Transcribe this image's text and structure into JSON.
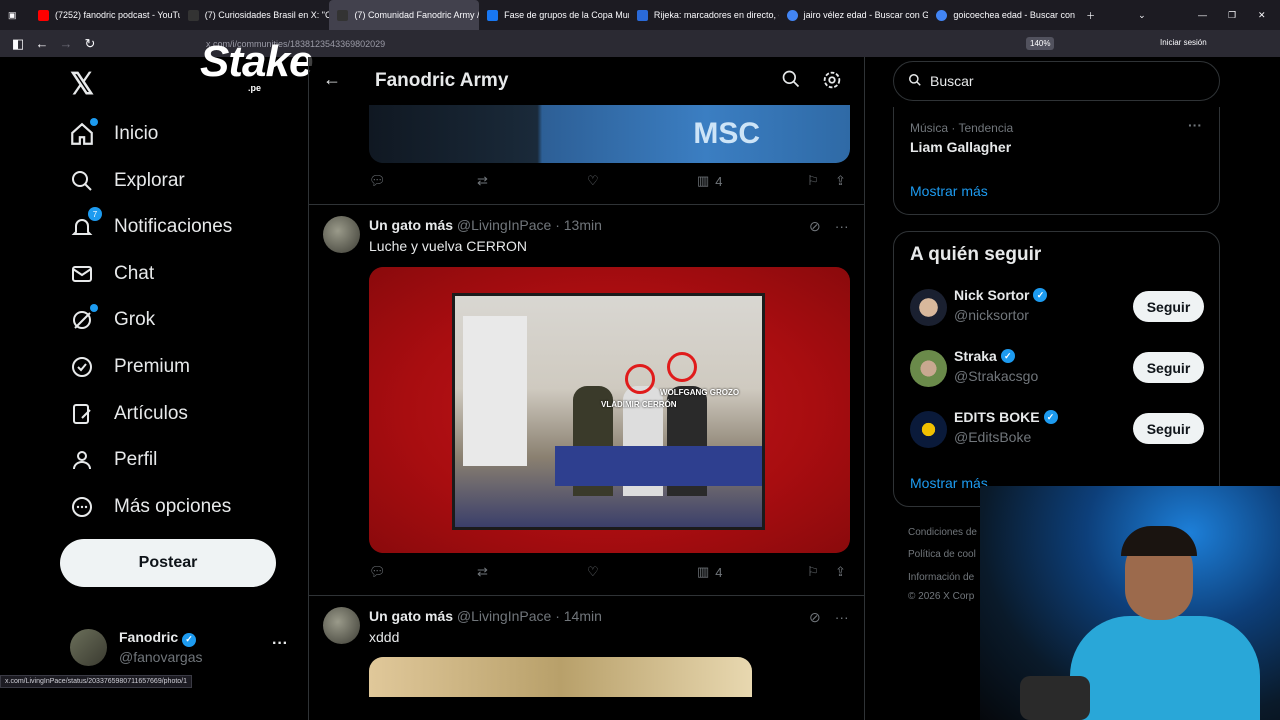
{
  "browser": {
    "tabs": [
      {
        "label": "(7252) fanodric podcast - YouTu",
        "color": "#ff0000"
      },
      {
        "label": "(7) Curiosidades Brasil en X: \"Cc",
        "color": "#333333"
      },
      {
        "label": "(7) Comunidad Fanodric Army /",
        "color": "#333333",
        "active": true
      },
      {
        "label": "Fase de grupos de la Copa Mun",
        "color": "#1877f2"
      },
      {
        "label": "Rijeka: marcadores en directo, c",
        "color": "#2a6ad8"
      },
      {
        "label": "jairo vélez edad - Buscar con G",
        "color": "#4285f4"
      },
      {
        "label": "goicoechea edad - Buscar con G",
        "color": "#4285f4"
      }
    ],
    "url": "x.com/i/communities/1838123543369802029",
    "zoom": "140%",
    "login": "Iniciar sesión",
    "status_url": "x.com/LivingInPace/status/2033765980711657669/photo/1"
  },
  "overlay": {
    "brand": "Stake",
    "brand_sub": ".pe"
  },
  "sidebar": {
    "items": [
      {
        "label": "Inicio",
        "icon": "home-icon"
      },
      {
        "label": "Explorar",
        "icon": "search-icon"
      },
      {
        "label": "Notificaciones",
        "icon": "bell-icon",
        "badge": "7"
      },
      {
        "label": "Chat",
        "icon": "mail-icon"
      },
      {
        "label": "Grok",
        "icon": "grok-icon"
      },
      {
        "label": "Premium",
        "icon": "premium-icon"
      },
      {
        "label": "Artículos",
        "icon": "article-icon"
      },
      {
        "label": "Perfil",
        "icon": "person-icon"
      },
      {
        "label": "Más opciones",
        "icon": "more-circle-icon"
      }
    ],
    "post_button": "Postear",
    "account": {
      "name": "Fanodric",
      "handle": "@fanovargas"
    }
  },
  "main": {
    "title": "Fanodric Army",
    "top_image_text": "MSC",
    "top_actions": {
      "views": "4"
    },
    "tweets": [
      {
        "name": "Un gato más",
        "handle": "@LivingInPace",
        "time": "13min",
        "text": "Luche y vuelva CERRON",
        "views": "4",
        "caption1": "VLADIMIR CERRÓN",
        "caption2": "WOLFGANG GROZO"
      },
      {
        "name": "Un gato más",
        "handle": "@LivingInPace",
        "time": "14min",
        "text": "xddd"
      }
    ]
  },
  "right": {
    "search_placeholder": "Buscar",
    "trend": {
      "category": "Música · Tendencia",
      "name": "Liam Gallagher",
      "show_more": "Mostrar más"
    },
    "follow": {
      "title": "A quién seguir",
      "users": [
        {
          "name": "Nick Sortor",
          "handle": "@nicksortor",
          "button": "Seguir"
        },
        {
          "name": "Straka",
          "handle": "@Strakacsgo",
          "button": "Seguir"
        },
        {
          "name": "EDITS BOKE",
          "handle": "@EditsBoke",
          "button": "Seguir"
        }
      ],
      "show_more": "Mostrar más"
    },
    "footer": [
      "Condiciones de",
      "Política de cool",
      "Información de",
      "© 2026 X Corp"
    ]
  }
}
